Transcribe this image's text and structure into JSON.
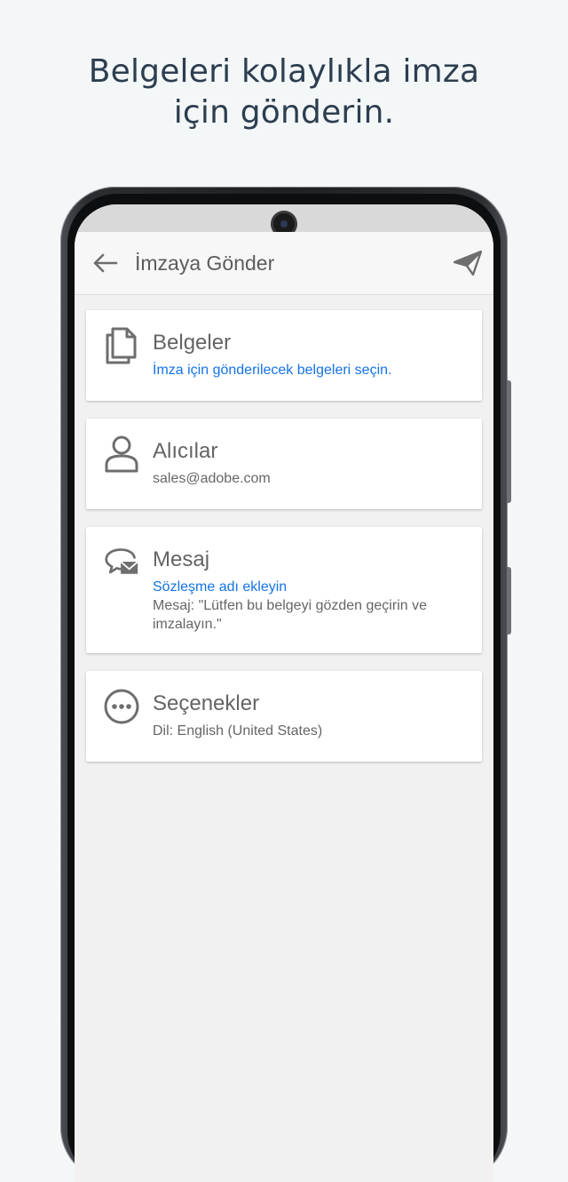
{
  "headline": {
    "line1": "Belgeleri kolaylıkla imza",
    "line2": "için gönderin."
  },
  "app_bar": {
    "title": "İmzaya Gönder",
    "back_icon": "arrow-left-icon",
    "send_icon": "paper-plane-icon"
  },
  "cards": {
    "documents": {
      "icon": "documents-icon",
      "title": "Belgeler",
      "link": "İmza için gönderilecek belgeleri seçin."
    },
    "recipients": {
      "icon": "person-icon",
      "title": "Alıcılar",
      "value": "sales@adobe.com"
    },
    "message": {
      "icon": "message-icon",
      "title": "Mesaj",
      "link": "Sözleşme adı ekleyin",
      "body": "Mesaj: \"Lütfen bu belgeyi gözden geçirin ve imzalayın.\""
    },
    "options": {
      "icon": "more-options-icon",
      "title": "Seçenekler",
      "value": "Dil: English (United States)"
    }
  },
  "colors": {
    "accent_link": "#1473e6",
    "icon_gray": "#6e6e6e",
    "background": "#f4f7f8",
    "headline": "#2c3e50"
  }
}
